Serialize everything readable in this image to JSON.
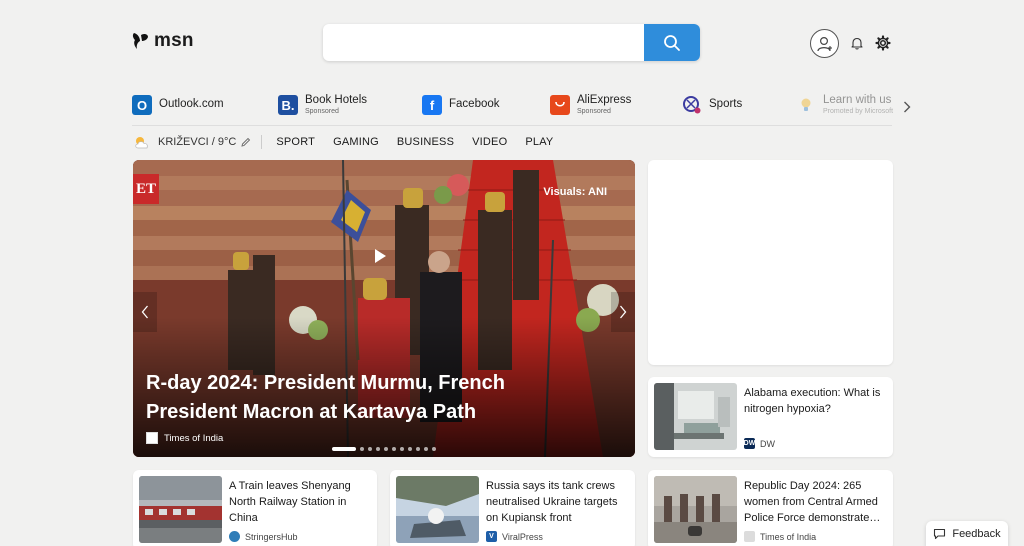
{
  "header": {
    "logo_text": "msn",
    "search": {
      "value": "",
      "placeholder": ""
    }
  },
  "quick_links": [
    {
      "name": "Outlook.com",
      "sponsored": ""
    },
    {
      "name": "Book Hotels",
      "sponsored": "Sponsored"
    },
    {
      "name": "Facebook",
      "sponsored": ""
    },
    {
      "name": "AliExpress",
      "sponsored": "Sponsored"
    },
    {
      "name": "Sports",
      "sponsored": ""
    },
    {
      "name": "Learn with us",
      "sponsored": "Promoted by Microsoft"
    }
  ],
  "nav": {
    "weather": "KRIŽEVCI / 9°C",
    "items": [
      "SPORT",
      "GAMING",
      "BUSINESS",
      "VIDEO",
      "PLAY"
    ]
  },
  "hero": {
    "credit": "Visuals: ANI",
    "title": "R-day 2024: President Murmu, French President Macron at Kartavya Path",
    "source": "Times of India",
    "logo_text": "ET"
  },
  "side_card": {
    "title": "Alabama execution: What is nitrogen hypoxia?",
    "source": "DW"
  },
  "cards": [
    {
      "title": "A Train leaves Shenyang North Railway Station in China",
      "source": "StringersHub"
    },
    {
      "title": "Russia says its tank crews neutralised Ukraine targets on Kupiansk front",
      "source": "ViralPress"
    },
    {
      "title": "Republic Day 2024: 265 women from Central Armed Police Force demonstrate…",
      "source": "Times of India"
    }
  ],
  "feedback_label": "Feedback",
  "colors": {
    "background": "#f1f1f0",
    "search_button": "#2f8ddb",
    "outlook": "#0f6cbd",
    "booking": "#1e4fa0",
    "facebook": "#1877f2",
    "aliexpress": "#e7481b",
    "sports": "#3b3ba0"
  }
}
